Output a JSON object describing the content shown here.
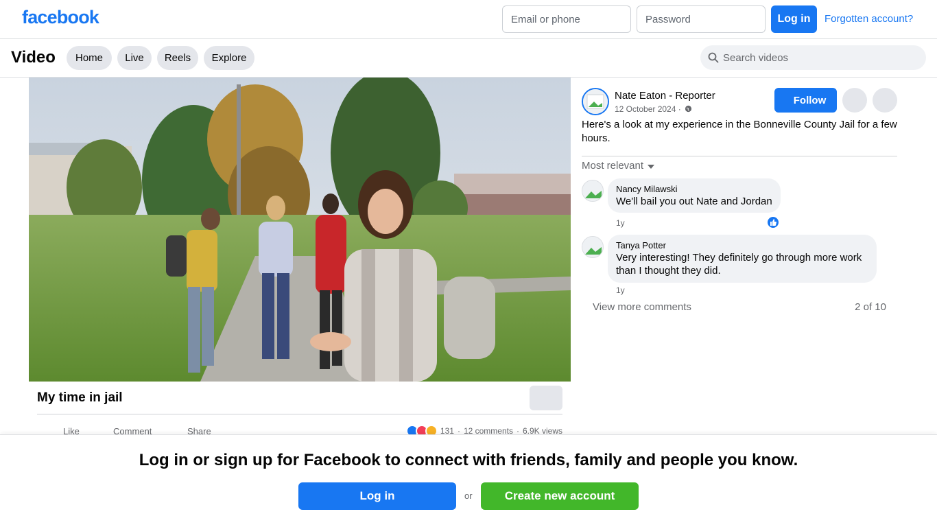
{
  "header": {
    "logo": "facebook",
    "email_placeholder": "Email or phone",
    "password_placeholder": "Password",
    "login_label": "Log in",
    "forgot_label": "Forgotten account?"
  },
  "video_nav": {
    "title": "Video",
    "tabs": [
      {
        "label": "Home"
      },
      {
        "label": "Live"
      },
      {
        "label": "Reels"
      },
      {
        "label": "Explore"
      }
    ],
    "search_placeholder": "Search videos"
  },
  "video_post": {
    "title": "My time in jail",
    "actions": {
      "like": "Like",
      "comment": "Comment",
      "share": "Share"
    },
    "stats": {
      "reactions": "131",
      "comments": "12 comments",
      "views": "6.9K views",
      "separator": "·"
    }
  },
  "author": {
    "name": "Nate Eaton - Reporter",
    "date": "12 October 2024 ·",
    "follow_label": "Follow",
    "caption": "Here's a look at my experience in the Bonneville County Jail for a few hours."
  },
  "comments": {
    "sort_label": "Most relevant",
    "items": [
      {
        "name": "Nancy Milawski",
        "text": "We'll bail you out Nate and Jordan",
        "time": "1y"
      },
      {
        "name": "Tanya Potter",
        "text": "Very interesting! They definitely go through more work than I thought they did.",
        "time": "1y"
      }
    ],
    "view_more": "View more comments",
    "count": "2 of 10"
  },
  "banner": {
    "text": "Log in or sign up for Facebook to connect with friends, family and people you know.",
    "login_label": "Log in",
    "or": "or",
    "create_label": "Create new account"
  },
  "colors": {
    "brand": "#1877f2",
    "create": "#42b72a"
  }
}
